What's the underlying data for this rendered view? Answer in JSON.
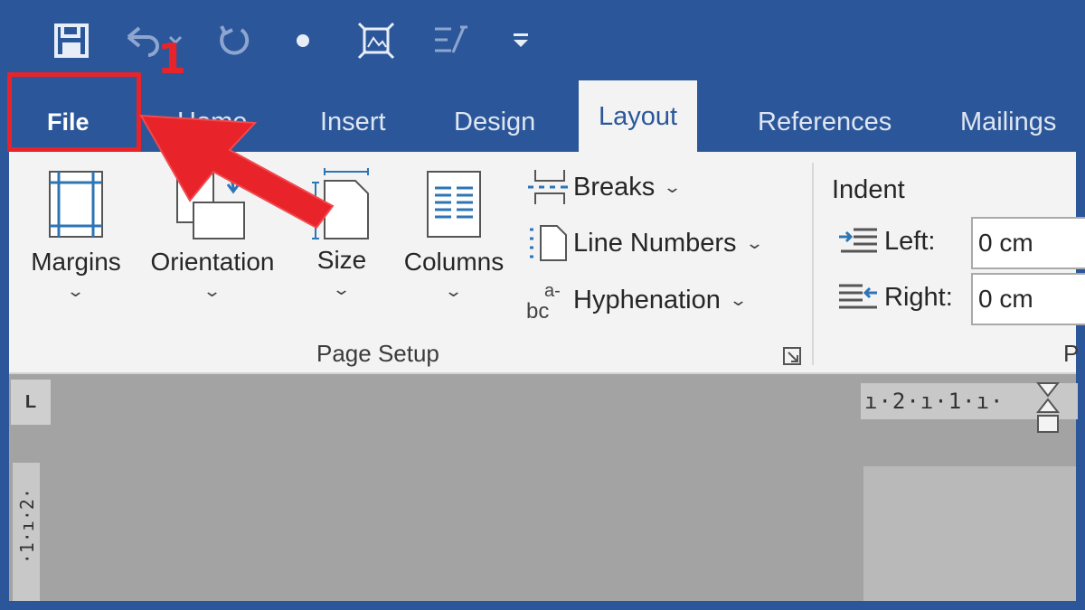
{
  "quick_access": {
    "icons": [
      "save-icon",
      "undo-icon",
      "redo-icon",
      "dot-icon",
      "fit-page-icon",
      "format-icon",
      "customize-icon"
    ]
  },
  "tabs": [
    {
      "label": "File",
      "active": false
    },
    {
      "label": "Home",
      "active": false
    },
    {
      "label": "Insert",
      "active": false
    },
    {
      "label": "Design",
      "active": false
    },
    {
      "label": "Layout",
      "active": true
    },
    {
      "label": "References",
      "active": false
    },
    {
      "label": "Mailings",
      "active": false
    }
  ],
  "annotation": {
    "step": "1",
    "color": "#e8232a"
  },
  "ribbon": {
    "page_setup": {
      "margins": "Margins",
      "orientation": "Orientation",
      "size": "Size",
      "columns": "Columns",
      "breaks": "Breaks",
      "line_numbers": "Line Numbers",
      "hyphenation": "Hyphenation",
      "group_label": "Page Setup",
      "chevron": "⌄"
    },
    "indent": {
      "title": "Indent",
      "left_label": "Left:",
      "left_value": "0 cm",
      "right_label": "Right:",
      "right_value": "0 cm"
    },
    "next_group_label": "P"
  },
  "rulers": {
    "horizontal": "ı·2·ı·1·ı·",
    "vertical": "·1·ı·2·",
    "corner": "L"
  },
  "colors": {
    "accent": "#2b579a",
    "ribbon": "#f3f3f3",
    "document": "#a3a3a3"
  }
}
